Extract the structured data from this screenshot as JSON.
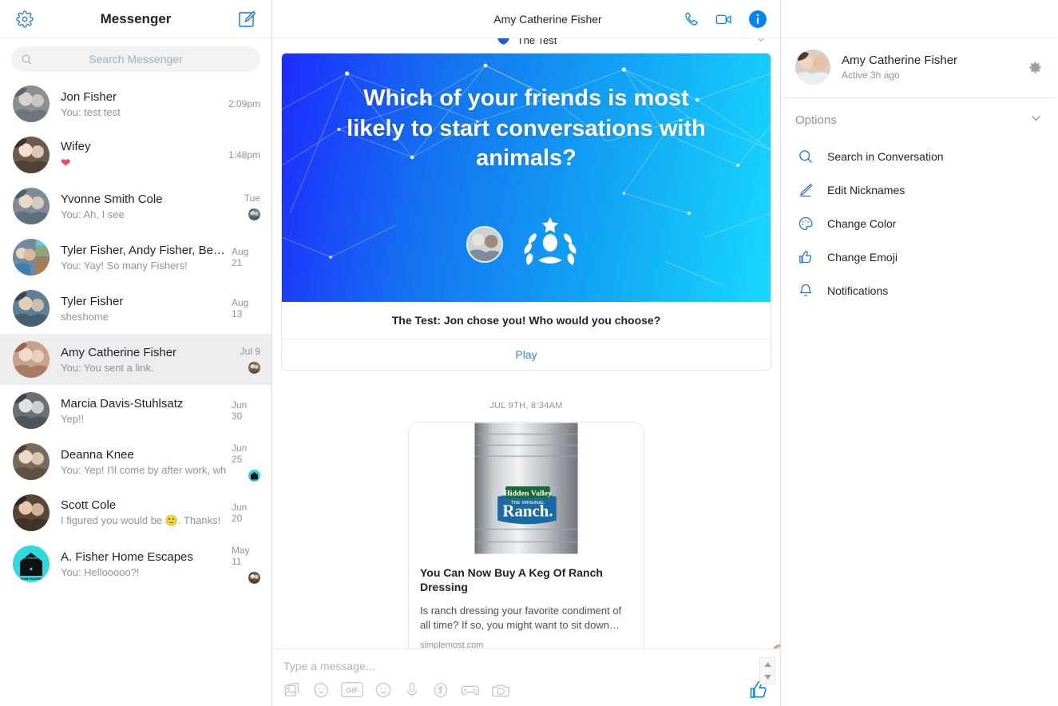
{
  "sidebar": {
    "title": "Messenger",
    "gear_icon": "gear-icon",
    "compose_icon": "compose-icon",
    "search": {
      "placeholder": "Search Messenger",
      "value": "",
      "icon": "search-icon"
    },
    "conversations": [
      {
        "name": "Jon Fisher",
        "snippet": "You: test test",
        "time": "2:09pm",
        "selected": false,
        "seen": false
      },
      {
        "name": "Wifey",
        "snippet": "❤",
        "time": "1:48pm",
        "selected": false,
        "seen": false,
        "is_heart": true
      },
      {
        "name": "Yvonne Smith Cole",
        "snippet": "You: Ah, I see",
        "time": "Tue",
        "selected": false,
        "seen": true
      },
      {
        "name": "Tyler Fisher, Andy Fisher, Be…",
        "snippet": "You: Yay! So many Fishers!",
        "time": "Aug 21",
        "selected": false,
        "seen": false
      },
      {
        "name": "Tyler Fisher",
        "snippet": "sheshome",
        "time": "Aug 13",
        "selected": false,
        "seen": false
      },
      {
        "name": "Amy Catherine Fisher",
        "snippet": "You: You sent a link.",
        "time": "Jul 9",
        "selected": true,
        "seen": true
      },
      {
        "name": "Marcia Davis-Stuhlsatz",
        "snippet": "Yep!!",
        "time": "Jun 30",
        "selected": false,
        "seen": false
      },
      {
        "name": "Deanna Knee",
        "snippet": "You: Yep! I'll come by after work, wh…",
        "time": "Jun 25",
        "selected": false,
        "seen": true
      },
      {
        "name": "Scott Cole",
        "snippet": "I figured you would be 🙂. Thanks!",
        "time": "Jun 20",
        "selected": false,
        "seen": false
      },
      {
        "name": "A. Fisher Home Escapes",
        "snippet": "You: Hellooooo?!",
        "time": "May 11",
        "selected": false,
        "seen": true
      }
    ]
  },
  "chat": {
    "title": "Amy Catherine Fisher",
    "actions": [
      {
        "name": "call-icon",
        "label": "Call"
      },
      {
        "name": "video-icon",
        "label": "Video Call"
      },
      {
        "name": "info-icon",
        "label": "Conversation Information"
      }
    ],
    "game_message": {
      "app_label": "The Test",
      "app_badge": "test-shield-icon",
      "question": "Which of your friends is most likely to start conversations with animals?",
      "caption": "The Test: Jon chose you! Who would you choose?",
      "play_label": "Play"
    },
    "timestamp_separator": "JUL 9TH, 8:34AM",
    "link_preview": {
      "title": "You Can Now Buy A Keg Of Ranch Dressing",
      "description": "Is ranch dressing your favorite condiment of all time? If so, you might want to sit down…",
      "source": "simplemost.com",
      "image_brand_top": "Hidden Valley",
      "image_brand_sub": "THE ORIGINAL",
      "image_brand_main": "Ranch."
    },
    "composer": {
      "placeholder": "Type a message...",
      "value": "",
      "tools": [
        {
          "name": "photo-icon",
          "label": "Photos"
        },
        {
          "name": "sticker-icon",
          "label": "Stickers"
        },
        {
          "name": "gif-icon",
          "label": "GIF"
        },
        {
          "name": "emoji-icon",
          "label": "Emoji"
        },
        {
          "name": "microphone-icon",
          "label": "Voice Clip"
        },
        {
          "name": "money-icon",
          "label": "Payment"
        },
        {
          "name": "games-icon",
          "label": "Games"
        },
        {
          "name": "camera-icon",
          "label": "Camera"
        }
      ],
      "like_icon": "thumbs-up-icon",
      "gif_label": "GIF"
    }
  },
  "details": {
    "name": "Amy Catherine Fisher",
    "active_status": "Active 3h ago",
    "gear_icon": "gear-icon",
    "options_label": "Options",
    "options_chevron": "chevron-down-icon",
    "options": [
      {
        "label": "Search in Conversation",
        "icon": "search-icon"
      },
      {
        "label": "Edit Nicknames",
        "icon": "pencil-icon"
      },
      {
        "label": "Change Color",
        "icon": "palette-icon"
      },
      {
        "label": "Change Emoji",
        "icon": "thumbs-up-icon"
      },
      {
        "label": "Notifications",
        "icon": "bell-icon"
      }
    ]
  },
  "colors": {
    "accent_blue": "#0084ff",
    "link_blue": "#2d88ff",
    "icon_blue": "#0084ff",
    "selected_row": "#ededed",
    "text_primary": "#1d2129",
    "text_secondary": "#8d949e",
    "heart_red": "#ed4956"
  }
}
